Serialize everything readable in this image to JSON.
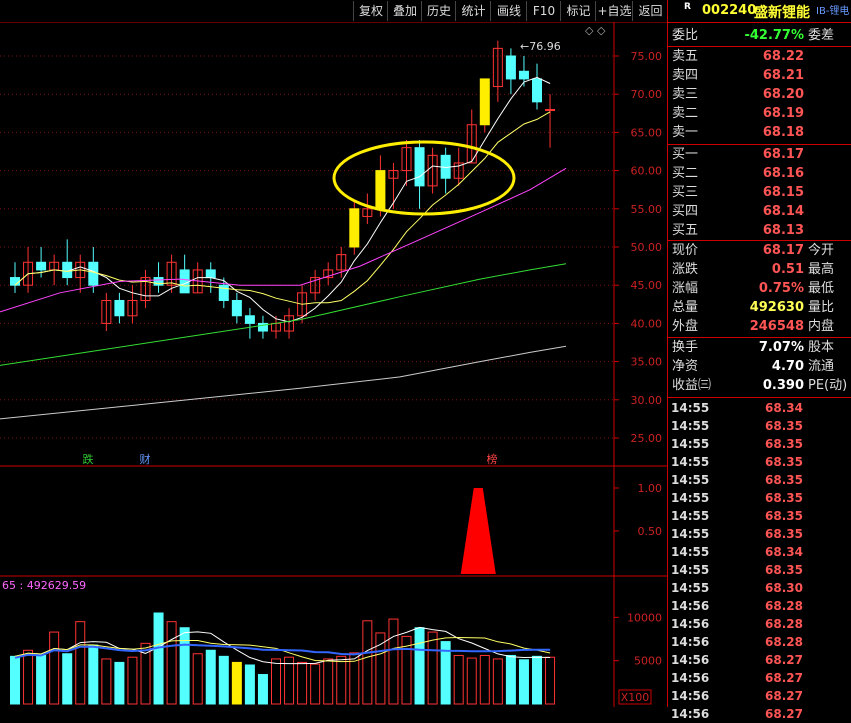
{
  "toolbar": {
    "buttons": [
      "复权",
      "叠加",
      "历史",
      "统计",
      "画线",
      "F10",
      "标记",
      "+自选",
      "返回"
    ]
  },
  "main_chart": {
    "high_label": "76.96",
    "markers": [
      {
        "text": "跌",
        "color": "#33cc33"
      },
      {
        "text": "财",
        "color": "#6699ff"
      },
      {
        "text": "榜",
        "color": "#ff4444"
      }
    ],
    "y_ticks": [
      "75.00",
      "70.00",
      "65.00",
      "60.00",
      "55.00",
      "50.00",
      "45.00",
      "40.00",
      "35.00",
      "30.00",
      "25.00"
    ],
    "indicator_ticks": [
      "1.00",
      "0.50"
    ],
    "volume_ticks": [
      "10000",
      "5000"
    ],
    "volume_header_prefix": "65 : ",
    "volume_header_value": "492629.59",
    "volume_unit": "X100"
  },
  "chart_data": {
    "type": "candlestick",
    "ylim": [
      25,
      77
    ],
    "candles": [
      [
        46,
        45,
        48,
        44
      ],
      [
        45,
        48,
        50,
        44
      ],
      [
        48,
        47,
        50,
        46
      ],
      [
        47,
        48,
        49,
        45
      ],
      [
        48,
        46,
        51,
        45
      ],
      [
        46,
        48,
        49,
        44
      ],
      [
        48,
        45,
        50,
        44
      ],
      [
        40,
        43,
        44,
        39
      ],
      [
        43,
        41,
        44,
        40
      ],
      [
        41,
        43,
        45,
        40
      ],
      [
        43,
        46,
        47,
        42
      ],
      [
        46,
        45,
        48,
        44
      ],
      [
        45,
        48,
        49,
        44
      ],
      [
        47,
        44,
        49,
        44
      ],
      [
        44,
        47,
        48,
        44
      ],
      [
        47,
        46,
        48,
        44
      ],
      [
        45,
        43,
        46,
        42
      ],
      [
        43,
        41,
        44,
        40
      ],
      [
        41,
        40,
        42,
        38
      ],
      [
        40,
        39,
        41,
        38
      ],
      [
        39,
        40,
        41,
        38
      ],
      [
        39,
        41,
        42,
        38
      ],
      [
        41,
        44,
        45,
        40
      ],
      [
        44,
        46,
        47,
        43
      ],
      [
        46,
        47,
        48,
        45
      ],
      [
        47,
        49,
        50,
        46
      ],
      [
        50,
        55,
        56,
        49
      ],
      [
        54,
        55,
        57,
        53
      ],
      [
        55,
        60,
        62,
        54
      ],
      [
        59,
        60,
        61,
        55
      ],
      [
        60,
        63,
        64,
        58
      ],
      [
        63,
        58,
        64,
        55
      ],
      [
        58,
        62,
        63,
        57
      ],
      [
        62,
        59,
        63,
        57
      ],
      [
        59,
        61,
        63,
        58
      ],
      [
        61,
        66,
        68,
        61
      ],
      [
        66,
        72,
        72,
        65
      ],
      [
        71,
        76,
        77,
        69
      ],
      [
        75,
        72,
        76,
        70
      ],
      [
        73,
        72,
        75,
        71
      ],
      [
        72,
        69,
        74,
        68
      ],
      [
        68,
        68,
        70,
        63
      ]
    ],
    "indicator": [
      0,
      0,
      0,
      0,
      0,
      0,
      0,
      0,
      0,
      0,
      0,
      0,
      0,
      0,
      0,
      0,
      0,
      0,
      0,
      0,
      0,
      0,
      0,
      0,
      0,
      0,
      0,
      0,
      0,
      0,
      0,
      0,
      0,
      0,
      0,
      1,
      1,
      0,
      0,
      0,
      0,
      0
    ],
    "volume": [
      5500,
      6200,
      5600,
      8300,
      5800,
      9500,
      6800,
      5200,
      4800,
      5400,
      7000,
      10500,
      9500,
      8800,
      5800,
      6200,
      5500,
      4800,
      4500,
      3400,
      5200,
      5400,
      4800,
      4600,
      5200,
      5500,
      5900,
      9600,
      8200,
      9800,
      7800,
      8800,
      8300,
      7200,
      5600,
      5300,
      5600,
      5200,
      5600,
      5100,
      5500,
      5400
    ],
    "volume_ylim": [
      0,
      12000
    ]
  },
  "quote_panel": {
    "code": "002240",
    "name": "盛新锂能",
    "tag": "R",
    "sector": "IB-锂电",
    "wei_bi_label": "委比",
    "wei_bi_value": "-42.77%",
    "wei_cha_label": "委差",
    "sell": [
      {
        "label": "卖五",
        "price": "68.22"
      },
      {
        "label": "卖四",
        "price": "68.21"
      },
      {
        "label": "卖三",
        "price": "68.20"
      },
      {
        "label": "卖二",
        "price": "68.19"
      },
      {
        "label": "卖一",
        "price": "68.18"
      }
    ],
    "buy": [
      {
        "label": "买一",
        "price": "68.17"
      },
      {
        "label": "买二",
        "price": "68.16"
      },
      {
        "label": "买三",
        "price": "68.15"
      },
      {
        "label": "买四",
        "price": "68.14"
      },
      {
        "label": "买五",
        "price": "68.13"
      }
    ],
    "stats": [
      {
        "label": "现价",
        "value": "68.17",
        "label2": "今开",
        "color": "#ff5555"
      },
      {
        "label": "涨跌",
        "value": "0.51",
        "label2": "最高",
        "color": "#ff5555"
      },
      {
        "label": "涨幅",
        "value": "0.75%",
        "label2": "最低",
        "color": "#ff5555"
      },
      {
        "label": "总量",
        "value": "492630",
        "label2": "量比",
        "color": "#ffff55"
      },
      {
        "label": "外盘",
        "value": "246548",
        "label2": "内盘",
        "color": "#ff5555"
      }
    ],
    "stats2": [
      {
        "label": "换手",
        "value": "7.07%",
        "label2": "股本"
      },
      {
        "label": "净资",
        "value": "4.70",
        "label2": "流通"
      },
      {
        "label": "收益㈢",
        "value": "0.390",
        "label2": "PE(动)"
      }
    ],
    "ticks": [
      {
        "time": "14:55",
        "price": "68.34"
      },
      {
        "time": "14:55",
        "price": "68.35"
      },
      {
        "time": "14:55",
        "price": "68.35"
      },
      {
        "time": "14:55",
        "price": "68.35"
      },
      {
        "time": "14:55",
        "price": "68.35"
      },
      {
        "time": "14:55",
        "price": "68.35"
      },
      {
        "time": "14:55",
        "price": "68.35"
      },
      {
        "time": "14:55",
        "price": "68.35"
      },
      {
        "time": "14:55",
        "price": "68.34"
      },
      {
        "time": "14:55",
        "price": "68.35"
      },
      {
        "time": "14:55",
        "price": "68.30"
      },
      {
        "time": "14:56",
        "price": "68.28"
      },
      {
        "time": "14:56",
        "price": "68.28"
      },
      {
        "time": "14:56",
        "price": "68.28"
      },
      {
        "time": "14:56",
        "price": "68.27"
      },
      {
        "time": "14:56",
        "price": "68.27"
      },
      {
        "time": "14:56",
        "price": "68.27"
      },
      {
        "time": "14:56",
        "price": "68.27"
      }
    ]
  }
}
